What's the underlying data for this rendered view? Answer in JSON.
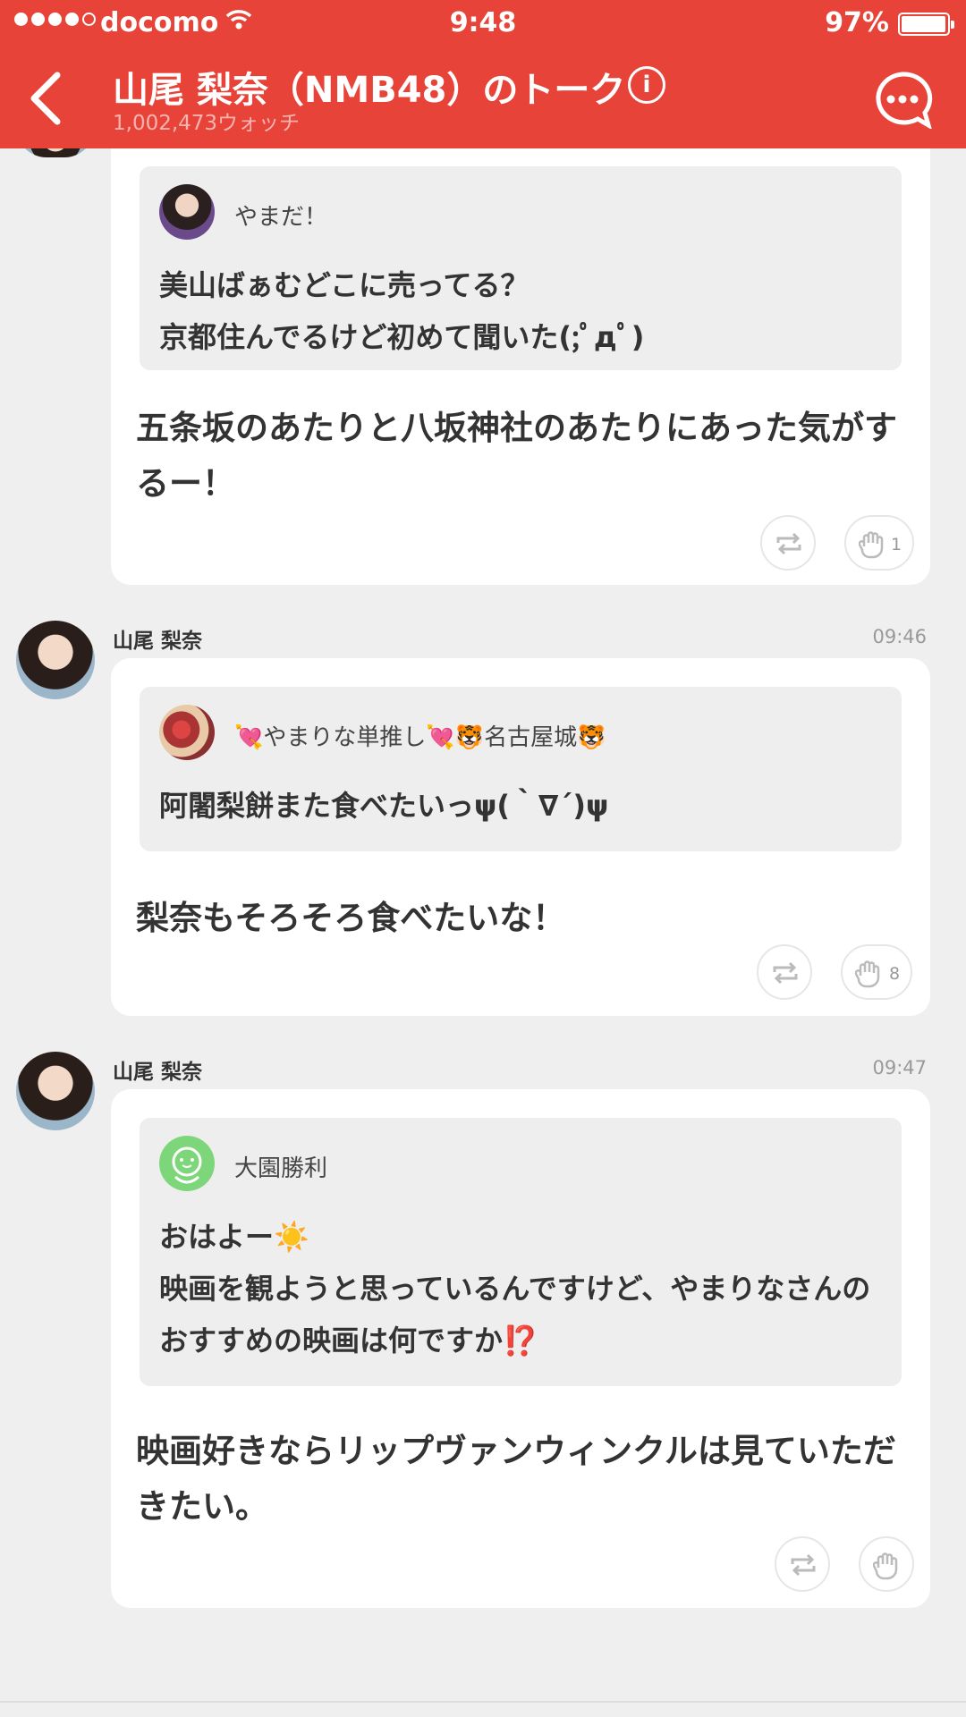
{
  "status_bar": {
    "carrier": "docomo",
    "time": "9:48",
    "battery": "97%",
    "battery_level": 0.97
  },
  "header": {
    "title": "山尾 梨奈（NMB48）のトーク",
    "watch_count": "1,002,473ウォッチ",
    "info_label": "i"
  },
  "colors": {
    "header_red": "#e84339",
    "background": "#efefef"
  },
  "messages": [
    {
      "quote": {
        "name": "やまだ！",
        "text": "美山ばぁむどこに売ってる？\n京都住んでるけど初めて聞いた(;ﾟдﾟ)"
      },
      "reply": "五条坂のあたりと八坂神社のあたりにあった気がするー！",
      "like_count": "1"
    },
    {
      "sender": "山尾 梨奈",
      "time": "09:46",
      "quote": {
        "name": "💘やまりな単推し💘🐯名古屋城🐯",
        "text": "阿闍梨餅また食べたいっψ(｀∇´)ψ"
      },
      "reply": "梨奈もそろそろ食べたいな！",
      "like_count": "8"
    },
    {
      "sender": "山尾 梨奈",
      "time": "09:47",
      "quote": {
        "name": "大園勝利",
        "text_line1": "おはよー☀️",
        "text_line2": "映画を観ようと思っているんですけど、やまりなさんのおすすめの映画は何ですか⁉️"
      },
      "reply": "映画好きならリップヴァンウィンクルは見ていただきたい。",
      "like_count": ""
    }
  ],
  "icons": {
    "back": "chevron-left-icon",
    "chat": "chat-bubble-icon",
    "retweet": "repost-icon",
    "like": "glove-icon"
  }
}
